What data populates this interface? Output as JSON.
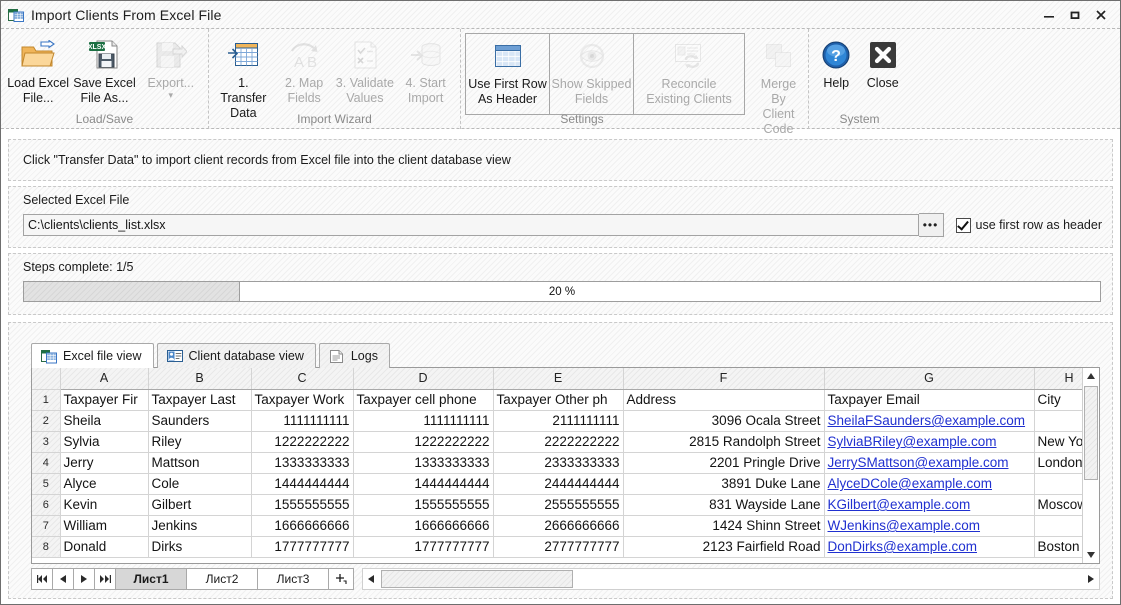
{
  "window": {
    "title": "Import Clients From Excel File",
    "icon": "excel-import-icon",
    "controls": {
      "minimize": "—",
      "maximize": "❒",
      "close": "✕"
    }
  },
  "ribbon": {
    "groups": [
      {
        "name": "Load/Save",
        "label": "Load/Save",
        "buttons": [
          {
            "id": "load-excel-file",
            "label": "Load Excel\nFile...",
            "icon": "open-folder-icon",
            "enabled": true,
            "active": false
          },
          {
            "id": "save-excel-file-as",
            "label": "Save Excel\nFile As...",
            "icon": "save-xlsx-icon",
            "enabled": true,
            "active": false
          },
          {
            "id": "export",
            "label": "Export...",
            "icon": "export-disk-icon",
            "enabled": false,
            "active": false,
            "dropdown": "▾"
          }
        ]
      },
      {
        "name": "Import Wizard",
        "label": "Import Wizard",
        "buttons": [
          {
            "id": "transfer-data",
            "label": "1. Transfer\nData",
            "icon": "transfer-grid-icon",
            "enabled": true,
            "active": false
          },
          {
            "id": "map-fields",
            "label": "2. Map\nFields",
            "icon": "map-fields-ab-icon",
            "enabled": false,
            "active": false
          },
          {
            "id": "validate-values",
            "label": "3. Validate\nValues",
            "icon": "validate-checklist-icon",
            "enabled": false,
            "active": false
          },
          {
            "id": "start-import",
            "label": "4. Start\nImport",
            "icon": "database-import-icon",
            "enabled": false,
            "active": false
          }
        ]
      },
      {
        "name": "Settings",
        "label": "Settings",
        "framed": [
          {
            "id": "use-first-row-as-header",
            "label": "Use First Row\nAs Header",
            "icon": "table-header-icon",
            "enabled": true,
            "active": true
          },
          {
            "id": "show-skipped-fields",
            "label": "Show Skipped\nFields",
            "icon": "eye-icon",
            "enabled": false,
            "active": false
          },
          {
            "id": "reconcile-existing-clients",
            "label": "Reconcile\nExisting Clients",
            "icon": "reconcile-sync-icon",
            "enabled": false,
            "active": false
          }
        ],
        "buttons": [
          {
            "id": "merge-by-client-code",
            "label": "Merge By\nClient Code",
            "icon": "merge-squares-icon",
            "enabled": false,
            "active": false
          }
        ]
      },
      {
        "name": "System",
        "label": "System",
        "buttons": [
          {
            "id": "help",
            "label": "Help",
            "icon": "help-question-icon",
            "enabled": true,
            "active": false
          },
          {
            "id": "close",
            "label": "Close",
            "icon": "close-x-icon",
            "enabled": true,
            "active": false
          }
        ]
      }
    ]
  },
  "hint": {
    "text": "Click \"Transfer Data\" to import client records from Excel file into the client database view"
  },
  "file_section": {
    "label": "Selected Excel File",
    "path": "C:\\clients\\clients_list.xlsx",
    "placeholder": "C:\\clients\\clients_list.xlsx",
    "browse_label": "•••",
    "checkbox_label": "use first row as header",
    "checkbox_checked": true
  },
  "progress_section": {
    "steps_label": "Steps complete: 1/5",
    "percent_text": "20 %",
    "percent_value": 20
  },
  "view_tabs": [
    {
      "id": "excel-file-view",
      "label": "Excel file view",
      "icon": "excel-sheet-icon",
      "active": true
    },
    {
      "id": "client-database-view",
      "label": "Client database view",
      "icon": "contact-card-icon",
      "active": false
    },
    {
      "id": "logs",
      "label": "Logs",
      "icon": "log-page-icon",
      "active": false
    }
  ],
  "sheet": {
    "column_letters": [
      "A",
      "B",
      "C",
      "D",
      "E",
      "F",
      "G",
      "H"
    ],
    "row_numbers": [
      "1",
      "2",
      "3",
      "4",
      "5",
      "6",
      "7",
      "8"
    ],
    "rows": [
      {
        "n": "1",
        "cells": [
          "Taxpayer Fir",
          "Taxpayer Last",
          "Taxpayer Work",
          "Taxpayer cell phone",
          "Taxpayer Other ph",
          "Address",
          "Taxpayer Email",
          "City"
        ],
        "align": [
          "left",
          "left",
          "left",
          "left",
          "left",
          "left",
          "left",
          "left"
        ],
        "styles": [
          "",
          "",
          "",
          "",
          "",
          "",
          "",
          ""
        ]
      },
      {
        "n": "2",
        "cells": [
          "Sheila",
          "Saunders",
          "1111111111",
          "1111111111",
          "2111111111",
          "3096 Ocala Street",
          "SheilaFSaunders@example.com",
          ""
        ],
        "align": [
          "left",
          "left",
          "right",
          "right",
          "right",
          "right",
          "left",
          "left"
        ],
        "styles": [
          "",
          "",
          "",
          "",
          "",
          "",
          "email",
          ""
        ]
      },
      {
        "n": "3",
        "cells": [
          "Sylvia",
          "Riley",
          "1222222222",
          "1222222222",
          "2222222222",
          "2815 Randolph Street",
          "SylviaBRiley@example.com",
          "New York"
        ],
        "align": [
          "left",
          "left",
          "right",
          "right",
          "right",
          "right",
          "left",
          "left"
        ],
        "styles": [
          "",
          "",
          "",
          "",
          "",
          "",
          "email",
          ""
        ]
      },
      {
        "n": "4",
        "cells": [
          "Jerry",
          "Mattson",
          "1333333333",
          "1333333333",
          "2333333333",
          "2201 Pringle Drive",
          "JerrySMattson@example.com",
          "London"
        ],
        "align": [
          "left",
          "left",
          "right",
          "right",
          "right",
          "right",
          "left",
          "left"
        ],
        "styles": [
          "",
          "",
          "",
          "",
          "",
          "",
          "email",
          ""
        ]
      },
      {
        "n": "5",
        "cells": [
          "Alyce",
          "Cole",
          "1444444444",
          "1444444444",
          "2444444444",
          "3891 Duke Lane",
          "AlyceDCole@example.com",
          ""
        ],
        "align": [
          "left",
          "left",
          "right",
          "right",
          "right",
          "right",
          "left",
          "left"
        ],
        "styles": [
          "",
          "",
          "",
          "",
          "",
          "",
          "email",
          ""
        ]
      },
      {
        "n": "6",
        "cells": [
          "Kevin",
          "Gilbert",
          "1555555555",
          "1555555555",
          "2555555555",
          "831 Wayside Lane",
          "KGilbert@example.com",
          "Moscow"
        ],
        "align": [
          "left",
          "left",
          "right",
          "right",
          "right",
          "right",
          "left",
          "left"
        ],
        "styles": [
          "",
          "",
          "",
          "",
          "",
          "",
          "email",
          ""
        ]
      },
      {
        "n": "7",
        "cells": [
          "William",
          "Jenkins",
          "1666666666",
          "1666666666",
          "2666666666",
          "1424 Shinn Street",
          "WJenkins@example.com",
          ""
        ],
        "align": [
          "left",
          "left",
          "right",
          "right",
          "right",
          "right",
          "left",
          "left"
        ],
        "styles": [
          "",
          "",
          "",
          "",
          "",
          "",
          "email",
          ""
        ]
      },
      {
        "n": "8",
        "cells": [
          "Donald",
          "Dirks",
          "1777777777",
          "1777777777",
          "2777777777",
          "2123 Fairfield Road",
          "DonDirks@example.com",
          "Boston"
        ],
        "align": [
          "left",
          "left",
          "right",
          "right",
          "right",
          "right",
          "left",
          "left"
        ],
        "styles": [
          "",
          "",
          "",
          "",
          "",
          "",
          "email",
          ""
        ]
      }
    ]
  },
  "sheet_bar": {
    "nav": [
      "⏮",
      "◀",
      "▶",
      "⏭"
    ],
    "tabs": [
      {
        "label": "Лист1",
        "active": true
      },
      {
        "label": "Лист2",
        "active": false
      },
      {
        "label": "Лист3",
        "active": false
      }
    ],
    "add_label": "✚"
  },
  "colors": {
    "email_link": "#2030d0",
    "accent_blue": "#3a76c4",
    "folder_orange": "#e8a33d",
    "excel_green": "#1d7044"
  }
}
